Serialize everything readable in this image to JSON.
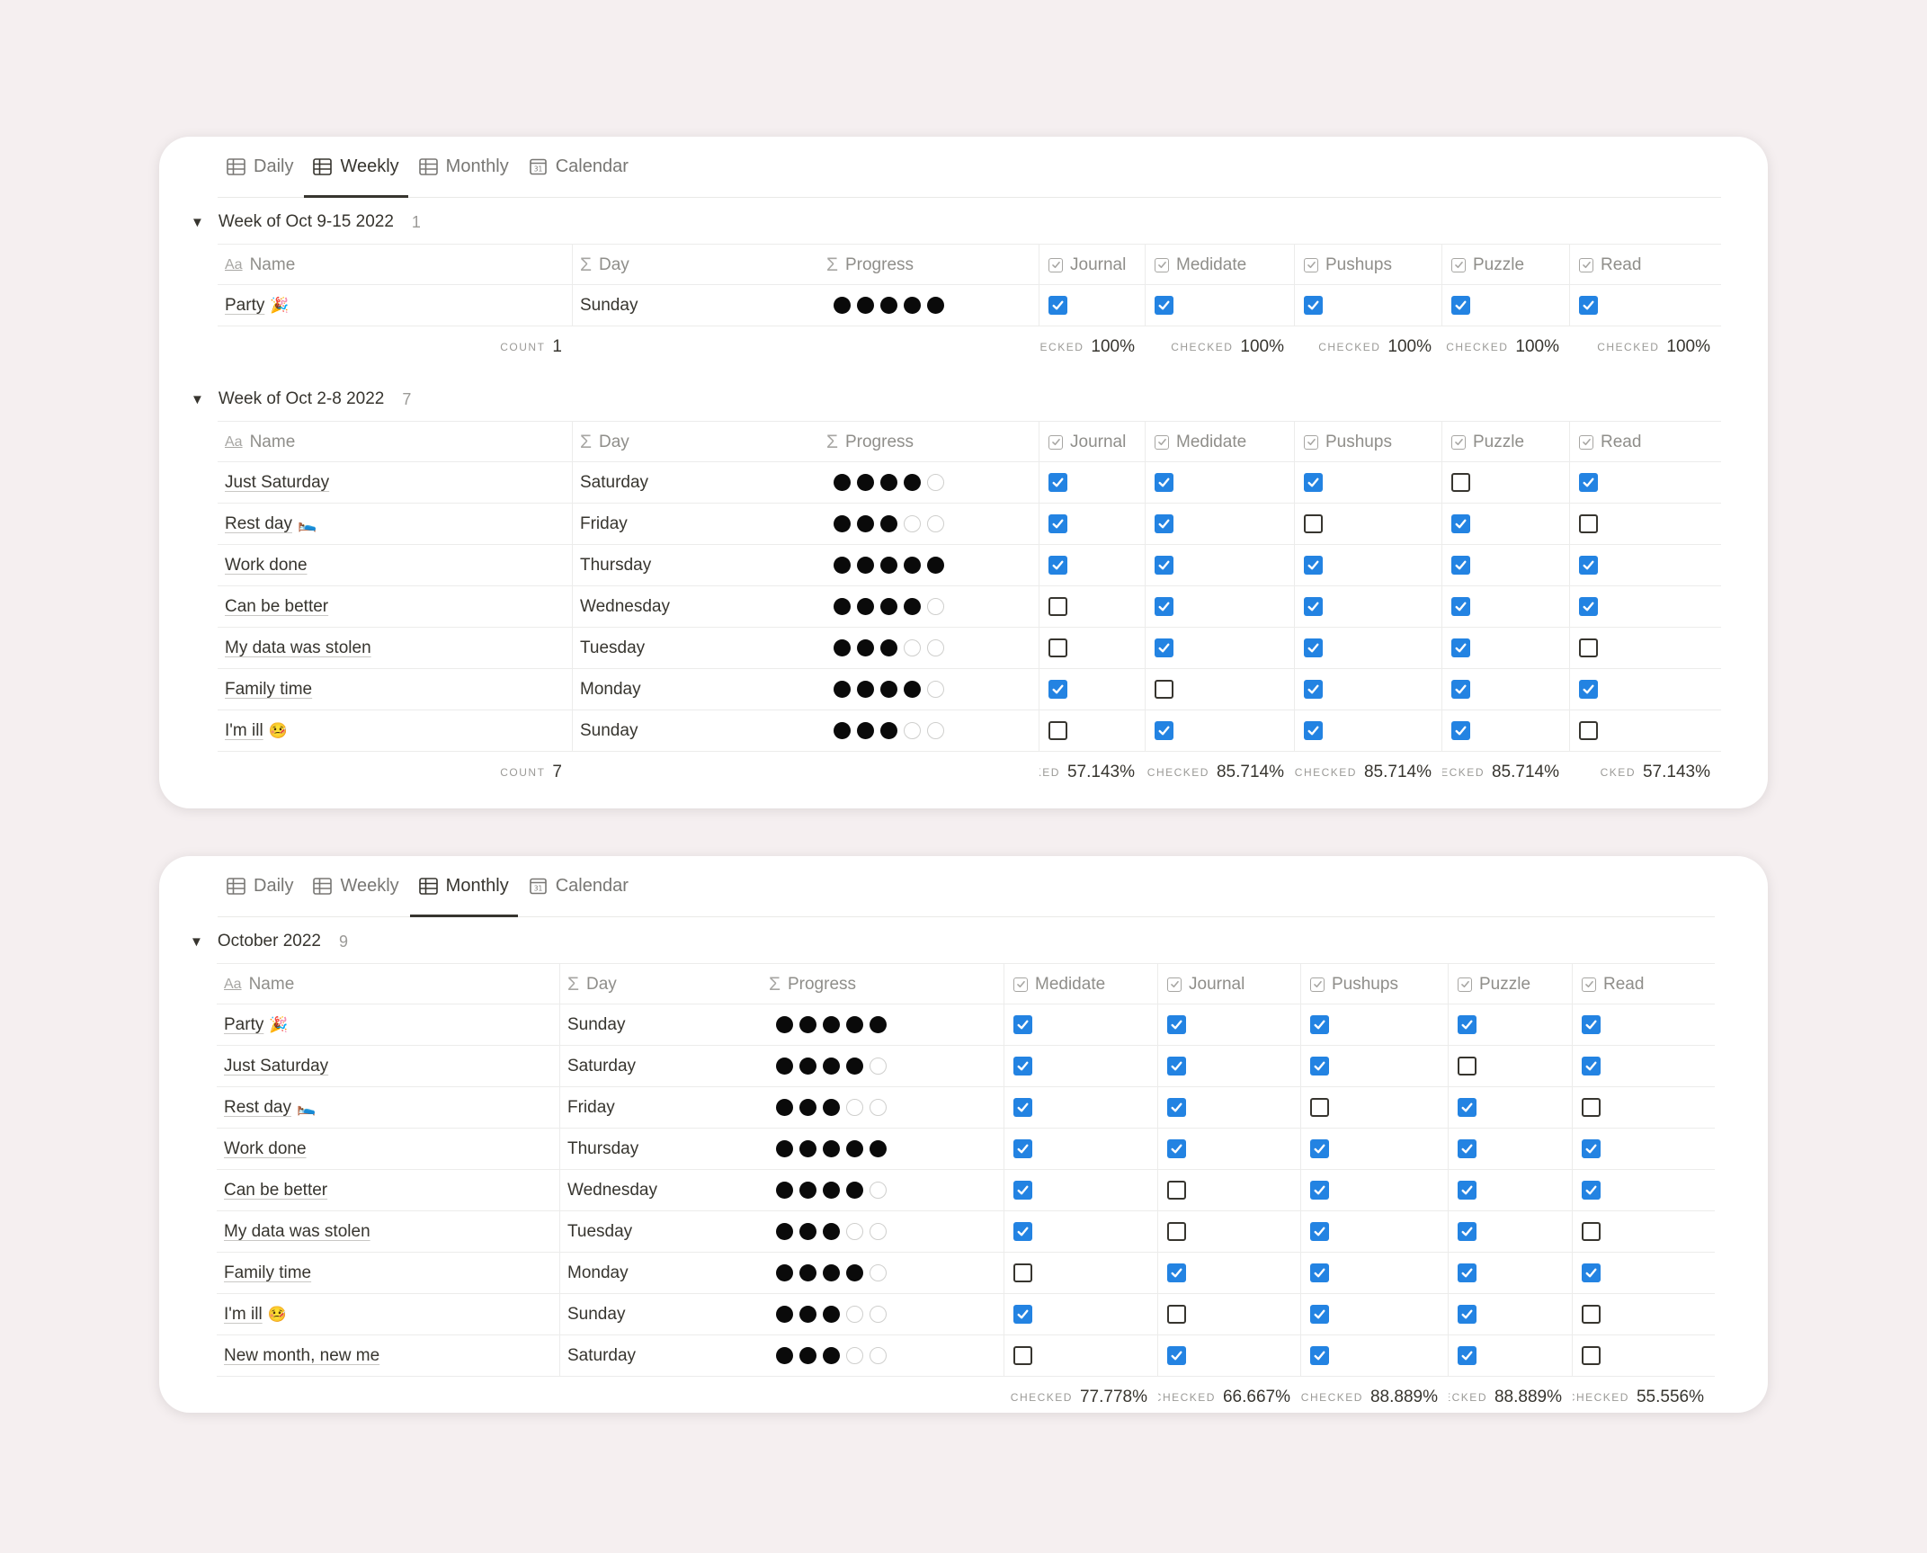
{
  "icons": {
    "table": "table-icon",
    "calendar": "calendar-icon",
    "text_prop": "text-property-icon",
    "formula_prop": "formula-sigma-icon",
    "checkbox_prop": "checkbox-property-icon"
  },
  "colors": {
    "background": "#f5eff0",
    "checkbox_on": "#2383e2",
    "card": "#ffffff"
  },
  "weekly_view": {
    "tabs": [
      {
        "label": "Daily",
        "icon": "table",
        "active": false
      },
      {
        "label": "Weekly",
        "icon": "table",
        "active": true
      },
      {
        "label": "Monthly",
        "icon": "table",
        "active": false
      },
      {
        "label": "Calendar",
        "icon": "calendar",
        "active": false
      }
    ],
    "columns": [
      "Name",
      "Day",
      "Progress",
      "Journal",
      "Medidate",
      "Pushups",
      "Puzzle",
      "Read"
    ],
    "groups": [
      {
        "title": "Week of Oct 9-15 2022",
        "count": "1",
        "rows": [
          {
            "name": "Party",
            "emoji": "🎉",
            "day": "Sunday",
            "progress": 5,
            "checks": [
              true,
              true,
              true,
              true,
              true
            ]
          }
        ],
        "footer": {
          "count_label": "COUNT",
          "count_value": "1",
          "checked": [
            {
              "label": "HECKED",
              "value": "100%"
            },
            {
              "label": "CHECKED",
              "value": "100%"
            },
            {
              "label": "CHECKED",
              "value": "100%"
            },
            {
              "label": "CHECKED",
              "value": "100%"
            },
            {
              "label": "CHECKED",
              "value": "100%"
            }
          ]
        }
      },
      {
        "title": "Week of Oct 2-8 2022",
        "count": "7",
        "rows": [
          {
            "name": "Just Saturday",
            "emoji": "",
            "day": "Saturday",
            "progress": 4,
            "checks": [
              true,
              true,
              true,
              false,
              true
            ]
          },
          {
            "name": "Rest day",
            "emoji": "🛌",
            "day": "Friday",
            "progress": 3,
            "checks": [
              true,
              true,
              false,
              true,
              false
            ]
          },
          {
            "name": "Work done",
            "emoji": "",
            "day": "Thursday",
            "progress": 5,
            "checks": [
              true,
              true,
              true,
              true,
              true
            ]
          },
          {
            "name": "Can be better",
            "emoji": "",
            "day": "Wednesday",
            "progress": 4,
            "checks": [
              false,
              true,
              true,
              true,
              true
            ]
          },
          {
            "name": "My data was stolen",
            "emoji": "",
            "day": "Tuesday",
            "progress": 3,
            "checks": [
              false,
              true,
              true,
              true,
              false
            ]
          },
          {
            "name": "Family time",
            "emoji": "",
            "day": "Monday",
            "progress": 4,
            "checks": [
              true,
              false,
              true,
              true,
              true
            ]
          },
          {
            "name": "I'm ill",
            "emoji": "🤒",
            "day": "Sunday",
            "progress": 3,
            "checks": [
              false,
              true,
              true,
              true,
              false
            ]
          }
        ],
        "footer": {
          "count_label": "COUNT",
          "count_value": "7",
          "checked": [
            {
              "label": "KED",
              "value": "57.143%"
            },
            {
              "label": "CHECKED",
              "value": "85.714%"
            },
            {
              "label": "CHECKED",
              "value": "85.714%"
            },
            {
              "label": "HECKED",
              "value": "85.714%"
            },
            {
              "label": "CKED",
              "value": "57.143%"
            }
          ]
        }
      }
    ]
  },
  "monthly_view": {
    "tabs": [
      {
        "label": "Daily",
        "icon": "table",
        "active": false
      },
      {
        "label": "Weekly",
        "icon": "table",
        "active": false
      },
      {
        "label": "Monthly",
        "icon": "table",
        "active": true
      },
      {
        "label": "Calendar",
        "icon": "calendar",
        "active": false
      }
    ],
    "columns": [
      "Name",
      "Day",
      "Progress",
      "Medidate",
      "Journal",
      "Pushups",
      "Puzzle",
      "Read"
    ],
    "groups": [
      {
        "title": "October 2022",
        "count": "9",
        "rows": [
          {
            "name": "Party",
            "emoji": "🎉",
            "day": "Sunday",
            "progress": 5,
            "checks": [
              true,
              true,
              true,
              true,
              true
            ]
          },
          {
            "name": "Just Saturday",
            "emoji": "",
            "day": "Saturday",
            "progress": 4,
            "checks": [
              true,
              true,
              true,
              false,
              true
            ]
          },
          {
            "name": "Rest day",
            "emoji": "🛌",
            "day": "Friday",
            "progress": 3,
            "checks": [
              true,
              true,
              false,
              true,
              false
            ]
          },
          {
            "name": "Work done",
            "emoji": "",
            "day": "Thursday",
            "progress": 5,
            "checks": [
              true,
              true,
              true,
              true,
              true
            ]
          },
          {
            "name": "Can be better",
            "emoji": "",
            "day": "Wednesday",
            "progress": 4,
            "checks": [
              true,
              false,
              true,
              true,
              true
            ]
          },
          {
            "name": "My data was stolen",
            "emoji": "",
            "day": "Tuesday",
            "progress": 3,
            "checks": [
              true,
              false,
              true,
              true,
              false
            ]
          },
          {
            "name": "Family time",
            "emoji": "",
            "day": "Monday",
            "progress": 4,
            "checks": [
              false,
              true,
              true,
              true,
              true
            ]
          },
          {
            "name": "I'm ill",
            "emoji": "🤒",
            "day": "Sunday",
            "progress": 3,
            "checks": [
              true,
              false,
              true,
              true,
              false
            ]
          },
          {
            "name": "New month, new me",
            "emoji": "",
            "day": "Saturday",
            "progress": 3,
            "checks": [
              false,
              true,
              true,
              true,
              false
            ]
          }
        ],
        "footer": {
          "count_label": "",
          "count_value": "",
          "checked": [
            {
              "label": "CHECKED",
              "value": "77.778%"
            },
            {
              "label": "CHECKED",
              "value": "66.667%"
            },
            {
              "label": "CHECKED",
              "value": "88.889%"
            },
            {
              "label": "HECKED",
              "value": "88.889%"
            },
            {
              "label": "CHECKED",
              "value": "55.556%"
            }
          ]
        }
      }
    ]
  }
}
